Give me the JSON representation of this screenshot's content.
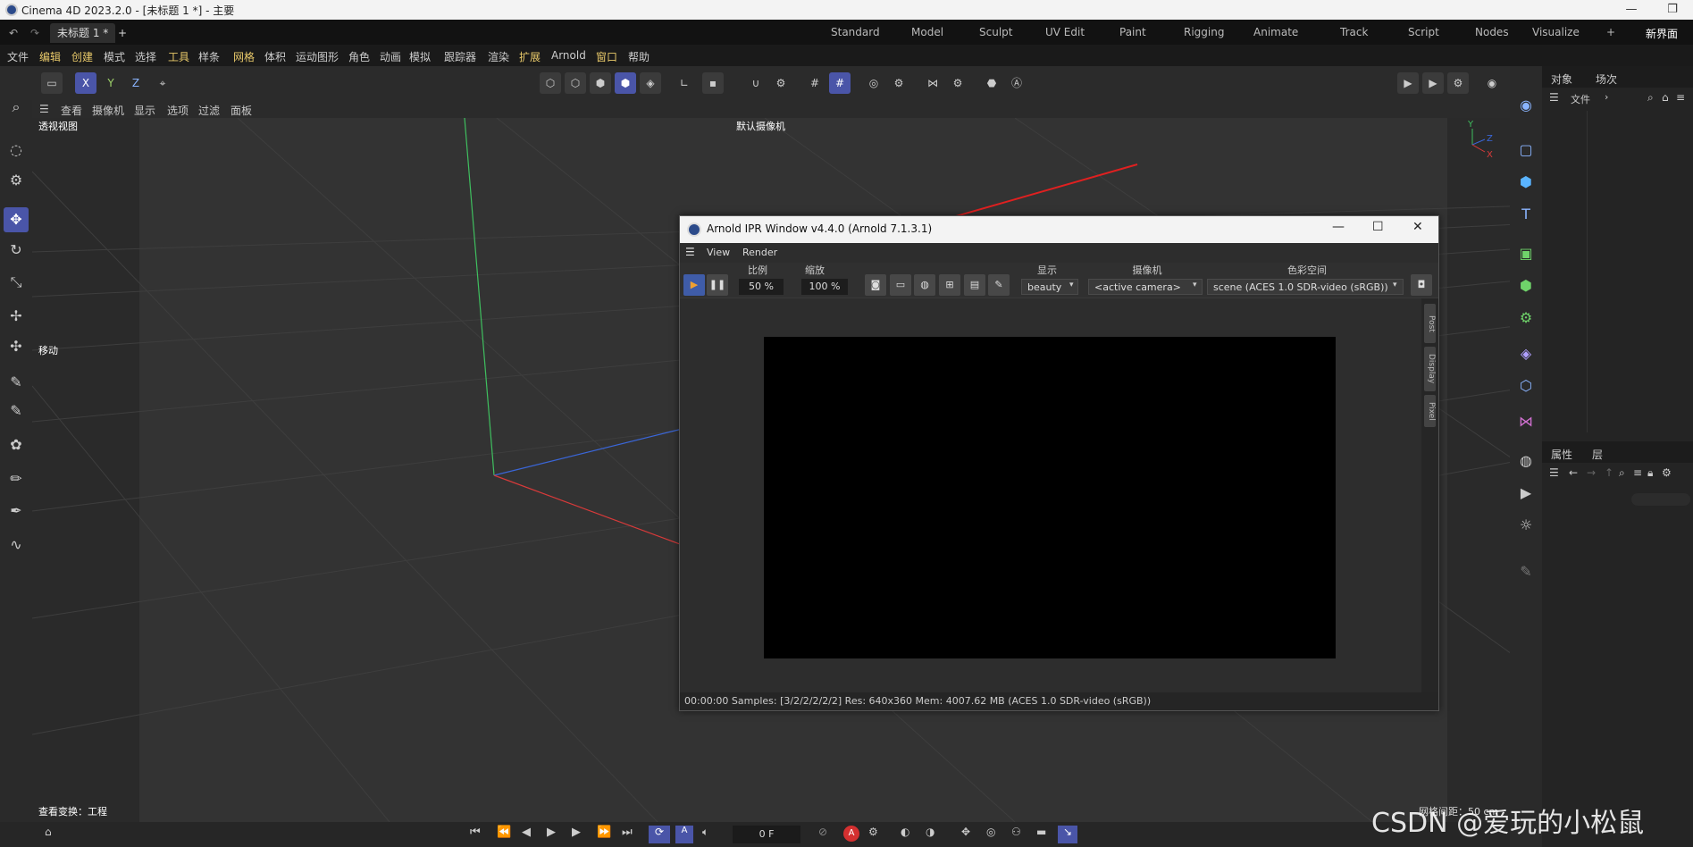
{
  "app": {
    "window_title": "Cinema 4D 2023.2.0 - [未标题 1 *] - 主要",
    "doc_tab": "未标题 1 *",
    "new_tab": "+",
    "workspaces": [
      "Standard",
      "Model",
      "Sculpt",
      "UV Edit",
      "Paint",
      "Rigging",
      "Animate",
      "Track",
      "Script",
      "Nodes",
      "Visualize"
    ],
    "new_layout": "新界面",
    "add_ws": "+"
  },
  "menu": [
    "文件",
    "编辑",
    "创建",
    "模式",
    "选择",
    "工具",
    "样条",
    "网格",
    "体积",
    "运动图形",
    "角色",
    "动画",
    "模拟",
    "跟踪器",
    "渲染",
    "扩展",
    "Arnold",
    "窗口",
    "帮助"
  ],
  "axes": {
    "x": "X",
    "y": "Y",
    "z": "Z"
  },
  "viewport": {
    "menu": [
      "查看",
      "摄像机",
      "显示",
      "选项",
      "过滤",
      "面板"
    ],
    "label": "透视视图",
    "camera": "默认摄像机",
    "tool_hint": "移动",
    "bottom_left": "查看变换：工程",
    "bottom_right": "网格间距：50 cm"
  },
  "timeline": {
    "frame": "0 F"
  },
  "right_panels": {
    "obj_tabs": [
      "对象",
      "场次"
    ],
    "obj_menu": "文件",
    "attr_tabs": [
      "属性",
      "层"
    ]
  },
  "arnold": {
    "title": "Arnold IPR Window v4.4.0 (Arnold 7.1.3.1)",
    "menu": [
      "View",
      "Render"
    ],
    "scale_label": "比例",
    "scale_value": "50 %",
    "zoom_label": "缩放",
    "zoom_value": "100 %",
    "display_label": "显示",
    "display_value": "beauty",
    "camera_label": "摄像机",
    "camera_value": "<active camera>",
    "colorspace_label": "色彩空间",
    "colorspace_value": "scene (ACES 1.0 SDR-video (sRGB))",
    "side_tabs": [
      "Post",
      "Display",
      "Pixel"
    ],
    "status": "00:00:00  Samples: [3/2/2/2/2/2]  Res: 640x360  Mem: 4007.62 MB  (ACES 1.0 SDR-video (sRGB))"
  },
  "watermark": "CSDN @爱玩的小松鼠"
}
